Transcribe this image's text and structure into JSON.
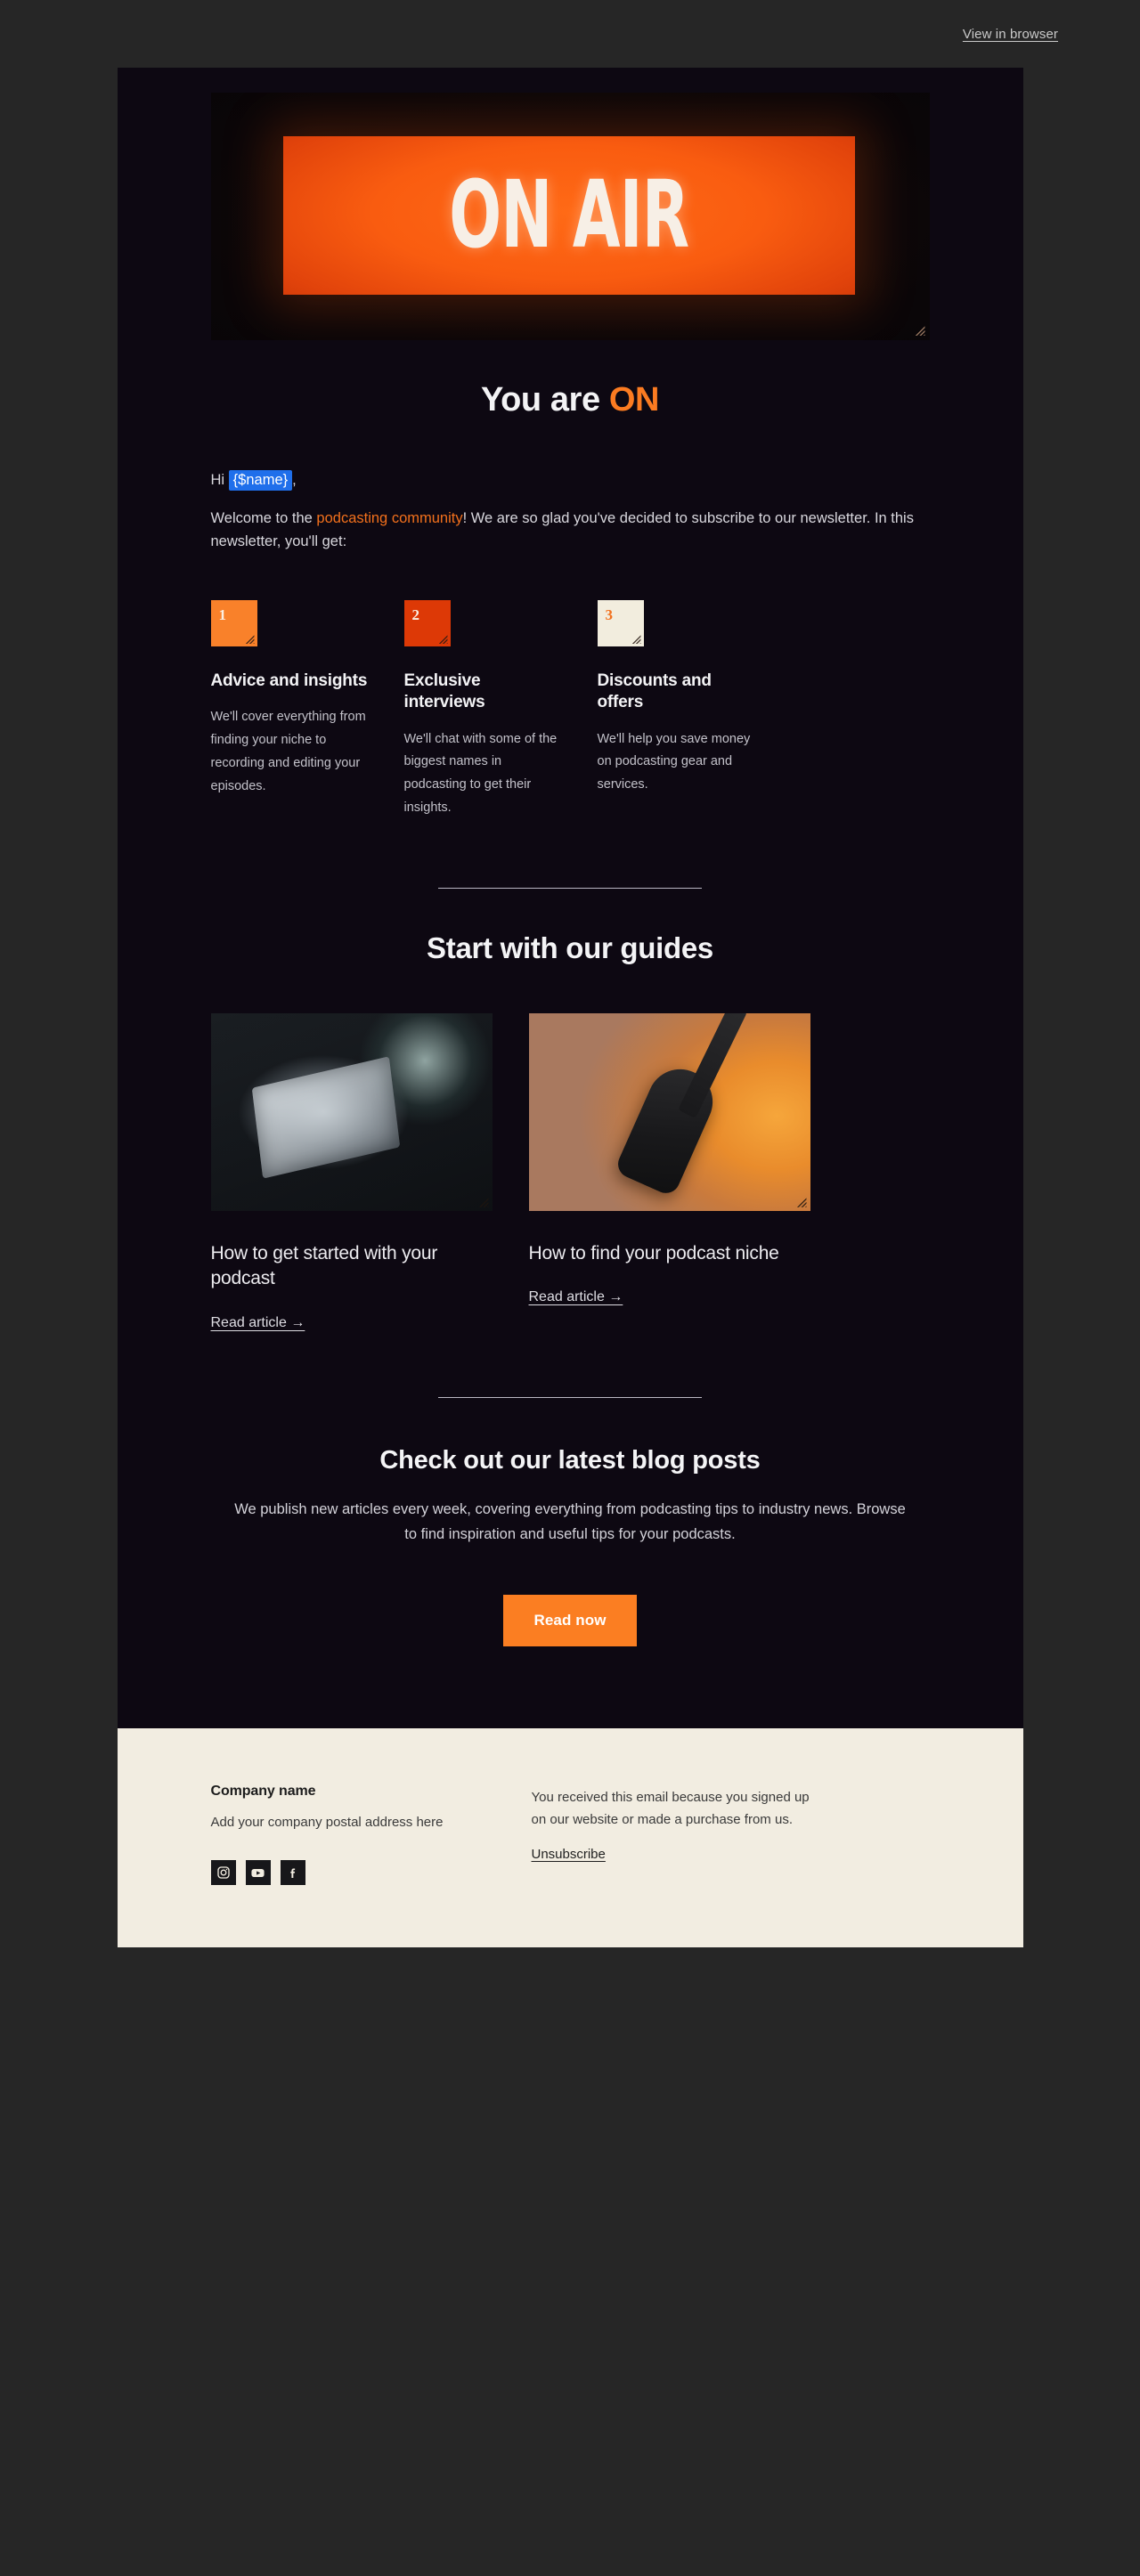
{
  "preheader": {
    "view_in_browser": "View in browser"
  },
  "hero": {
    "sign_text": "ON AIR",
    "alt": "on-air-sign-image"
  },
  "headline": {
    "lead": "You are ",
    "accent": "ON"
  },
  "intro": {
    "greeting_prefix": "Hi ",
    "merge_tag": "{$name}",
    "greeting_suffix": ",",
    "welcome_before": "Welcome to the ",
    "welcome_link": "podcasting community",
    "welcome_after": "! We are so glad you've decided to subscribe to our newsletter. In this newsletter, you'll get:"
  },
  "features": [
    {
      "number": "1",
      "badge_bg": "#F9812A",
      "badge_fg": "#FBEFE2",
      "title": "Advice and insights",
      "body": "We'll cover everything from finding your niche to recording and editing your episodes."
    },
    {
      "number": "2",
      "badge_bg": "#DD3906",
      "badge_fg": "#FBEFE2",
      "title": "Exclusive interviews",
      "body": "We'll chat with some of the biggest names in podcasting to get their insights."
    },
    {
      "number": "3",
      "badge_bg": "#F2EDDE",
      "badge_fg": "#F2701C",
      "title": "Discounts and offers",
      "body": "We'll help you save money on podcasting gear and services."
    }
  ],
  "guides": {
    "section_title": "Start with our guides",
    "items": [
      {
        "image_alt": "audio-mixer-photo",
        "title": "How to get started with your podcast",
        "link_label": "Read article →"
      },
      {
        "image_alt": "podcast-microphone-photo",
        "title": "How to find your podcast niche",
        "link_label": "Read article →"
      }
    ]
  },
  "blog": {
    "title": "Check out our latest blog posts",
    "body": "We publish new articles every week, covering everything from podcasting tips to industry news. Browse to find inspiration and useful tips for your podcasts.",
    "cta_label": "Read now"
  },
  "footer": {
    "company_name": "Company name",
    "address": "Add your company postal address here",
    "socials": [
      "instagram-icon",
      "youtube-icon",
      "facebook-icon"
    ],
    "legal": "You received this email because you signed up on our website or made a purchase from us.",
    "unsubscribe": "Unsubscribe"
  },
  "colors": {
    "page_bg": "#262626",
    "email_bg": "#0D0812",
    "accent_orange": "#FB7B21",
    "cta_orange": "#FB7E22",
    "merge_blue": "#1F6FEB",
    "footer_bg": "#F2EDE1"
  }
}
